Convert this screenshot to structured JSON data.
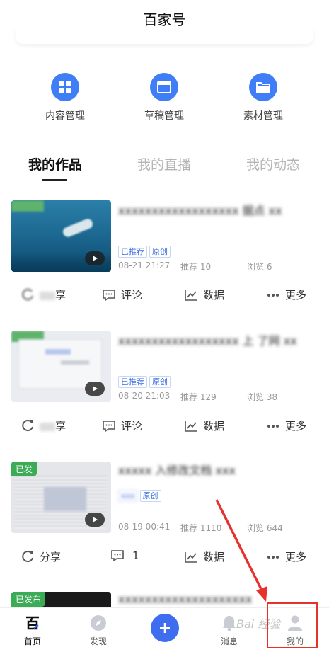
{
  "header": {
    "title": "百家号"
  },
  "quick_actions": [
    {
      "label": "内容管理",
      "icon": "grid-icon"
    },
    {
      "label": "草稿管理",
      "icon": "draft-icon"
    },
    {
      "label": "素材管理",
      "icon": "folder-icon"
    }
  ],
  "tabs": [
    {
      "label": "我的作品",
      "active": true
    },
    {
      "label": "我的直播",
      "active": false
    },
    {
      "label": "我的动态",
      "active": false
    }
  ],
  "posts": [
    {
      "status": "",
      "title": "xxxxxxxxxxxxxxxxxx 据点 xx",
      "badges": [
        "已推荐",
        "原创"
      ],
      "date": "08-21 21:27",
      "recommend": "推荐 10",
      "views": "浏览 6",
      "actions": [
        "享",
        "评论",
        "数据",
        "更多"
      ]
    },
    {
      "status": "",
      "title": "xxxxxxxxxxxxxxxxxx 上 了网 xx",
      "badges": [
        "已推荐",
        "原创"
      ],
      "date": "08-20 21:03",
      "recommend": "推荐 129",
      "views": "浏览 38",
      "actions": [
        "享",
        "评论",
        "数据",
        "更多"
      ]
    },
    {
      "status": "已发",
      "title": "xxxxx 入修改文档 xxx",
      "badges": [
        "xxx",
        "原创"
      ],
      "date": "08-19 00:41",
      "recommend": "推荐 1110",
      "views": "浏览 644",
      "actions": [
        "分享",
        "1",
        "数据",
        "更多"
      ]
    },
    {
      "status": "已发布",
      "title": "xxxxxxxxxxxxxxxxxxxx",
      "badges": [],
      "date": "",
      "recommend": "",
      "views": "",
      "actions": []
    }
  ],
  "bottom_nav": [
    {
      "label": "首页",
      "icon": "home-logo-icon"
    },
    {
      "label": "发现",
      "icon": "compass-icon"
    },
    {
      "label": "",
      "icon": "plus-icon"
    },
    {
      "label": "消息",
      "icon": "bell-icon"
    },
    {
      "label": "我的",
      "icon": "person-icon"
    }
  ],
  "watermark": "Bai 经验",
  "colors": {
    "accent": "#3f7ef6",
    "annotation": "#e8302c",
    "published_tag": "#3cab55"
  }
}
